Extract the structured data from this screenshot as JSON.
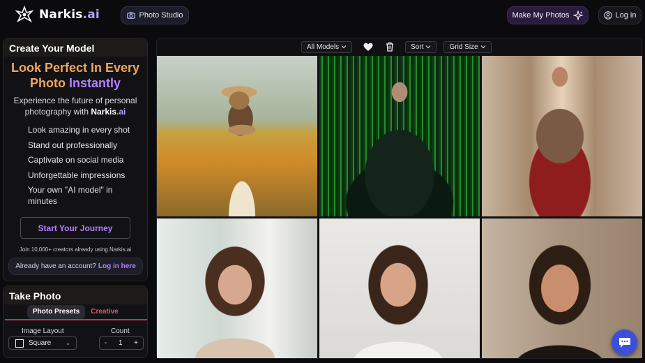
{
  "header": {
    "logo_text": "Narkis",
    "logo_suffix": ".ai",
    "photo_studio_label": "Photo Studio",
    "make_photos_label": "Make My Photos",
    "login_label": "Log in"
  },
  "sidebar": {
    "create_title": "Create Your Model",
    "hero_line1": "Look Perfect In Every",
    "hero_line2a": "Photo ",
    "hero_line2b": "Instantly",
    "subtitle_pre": "Experience the future of personal photography with ",
    "subtitle_brand": "Narkis",
    "subtitle_brand_suffix": ".ai",
    "features": [
      "Look amazing in every shot",
      "Stand out professionally",
      "Captivate on social media",
      "Unforgettable impressions",
      "Your own \"AI model\" in minutes"
    ],
    "journey_label": "Start Your Journey",
    "join_text": "Join 10,000+ creators already using Narkis.ai",
    "account_text": "Already have an account?",
    "account_link": "Log in here"
  },
  "take_photo": {
    "title": "Take Photo",
    "tab_presets": "Photo Presets",
    "tab_creative": "Creative",
    "layout_label": "Image Layout",
    "layout_value": "Square",
    "count_label": "Count",
    "count_value": "1",
    "minus": "-",
    "plus": "+"
  },
  "gallery_toolbar": {
    "models_label": "All Models",
    "sort_label": "Sort",
    "grid_label": "Grid Size"
  },
  "icons": {
    "brand": "logo-mark-icon",
    "camera": "camera-icon",
    "sparkle": "sparkle-icon",
    "user": "user-circle-icon",
    "heart": "heart-icon",
    "trash": "trash-icon",
    "chevron": "chevron-down-icon",
    "chat": "chat-icon"
  },
  "colors": {
    "accent_orange": "#f2a55e",
    "accent_purple": "#b380ff",
    "accent_red": "#e0556f",
    "chat_blue": "#3b4fd8"
  }
}
